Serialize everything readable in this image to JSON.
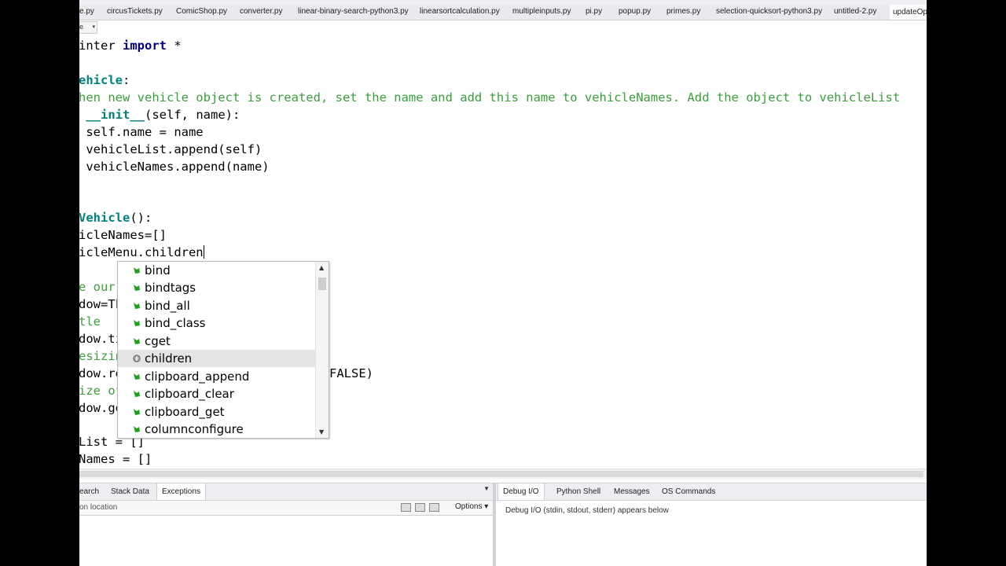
{
  "file_tabs": [
    {
      "label": "e.py"
    },
    {
      "label": "circusTickets.py"
    },
    {
      "label": "ComicShop.py"
    },
    {
      "label": "converter.py"
    },
    {
      "label": "linear-binary-search-python3.py"
    },
    {
      "label": "linearsortcalculation.py"
    },
    {
      "label": "multipleinputs.py"
    },
    {
      "label": "pi.py"
    },
    {
      "label": "popup.py"
    },
    {
      "label": "primes.py"
    },
    {
      "label": "selection-quicksort-python3.py"
    },
    {
      "label": "untitled-2.py"
    },
    {
      "label": "updateOpt"
    }
  ],
  "scope_selector": {
    "value": "e"
  },
  "code": {
    "l1": {
      "a": "inter ",
      "b": "import",
      "c": " *"
    },
    "l2": {
      "a": "ehicle",
      "b": ":"
    },
    "l3": "hen new vehicle object is created, set the name and add this name to vehicleNames. Add the object to vehicleList",
    "l4": {
      "a": " __init__",
      "b": "(self, name):"
    },
    "l5": " self.name = name",
    "l6": " vehicleList.append(self)",
    "l7": " vehicleNames.append(name)",
    "l8": {
      "a": "Vehicle",
      "b": "():"
    },
    "l9": "icleNames=[]",
    "l10": "icleMenu.children",
    "l11": "e our",
    "l12": "dow=Tk",
    "l13": "tle",
    "l14": "dow.ti",
    "l15": "esizin",
    "l16": "dow.re",
    "l16_tail": "FALSE)",
    "l17": "ize of",
    "l18": "dow.ge",
    "l19": "List = []",
    "l20": "Names = []"
  },
  "autocomplete": {
    "items": [
      {
        "label": "bind",
        "icon": "method-icon"
      },
      {
        "label": "bindtags",
        "icon": "method-icon"
      },
      {
        "label": "bind_all",
        "icon": "method-icon"
      },
      {
        "label": "bind_class",
        "icon": "method-icon"
      },
      {
        "label": "cget",
        "icon": "method-icon"
      },
      {
        "label": "children",
        "icon": "attribute-icon",
        "selected": true
      },
      {
        "label": "clipboard_append",
        "icon": "method-icon"
      },
      {
        "label": "clipboard_clear",
        "icon": "method-icon"
      },
      {
        "label": "clipboard_get",
        "icon": "method-icon"
      },
      {
        "label": "columnconfigure",
        "icon": "method-icon"
      }
    ]
  },
  "left_panel": {
    "tabs": [
      {
        "label": "earch"
      },
      {
        "label": "Stack Data"
      },
      {
        "label": "Exceptions",
        "active": true
      }
    ],
    "location_label": "on location",
    "options_label": "Options"
  },
  "right_panel": {
    "tabs": [
      {
        "label": "Debug I/O",
        "active": true
      },
      {
        "label": "Python Shell"
      },
      {
        "label": "Messages"
      },
      {
        "label": "OS Commands"
      }
    ],
    "info": "Debug I/O (stdin, stdout, stderr) appears below"
  },
  "colors": {
    "keyword": "#00007f",
    "class_name": "#007f7f",
    "comment": "#3b9e3b",
    "method_icon": "#1aa31a",
    "selection": "#e4e4e4"
  }
}
